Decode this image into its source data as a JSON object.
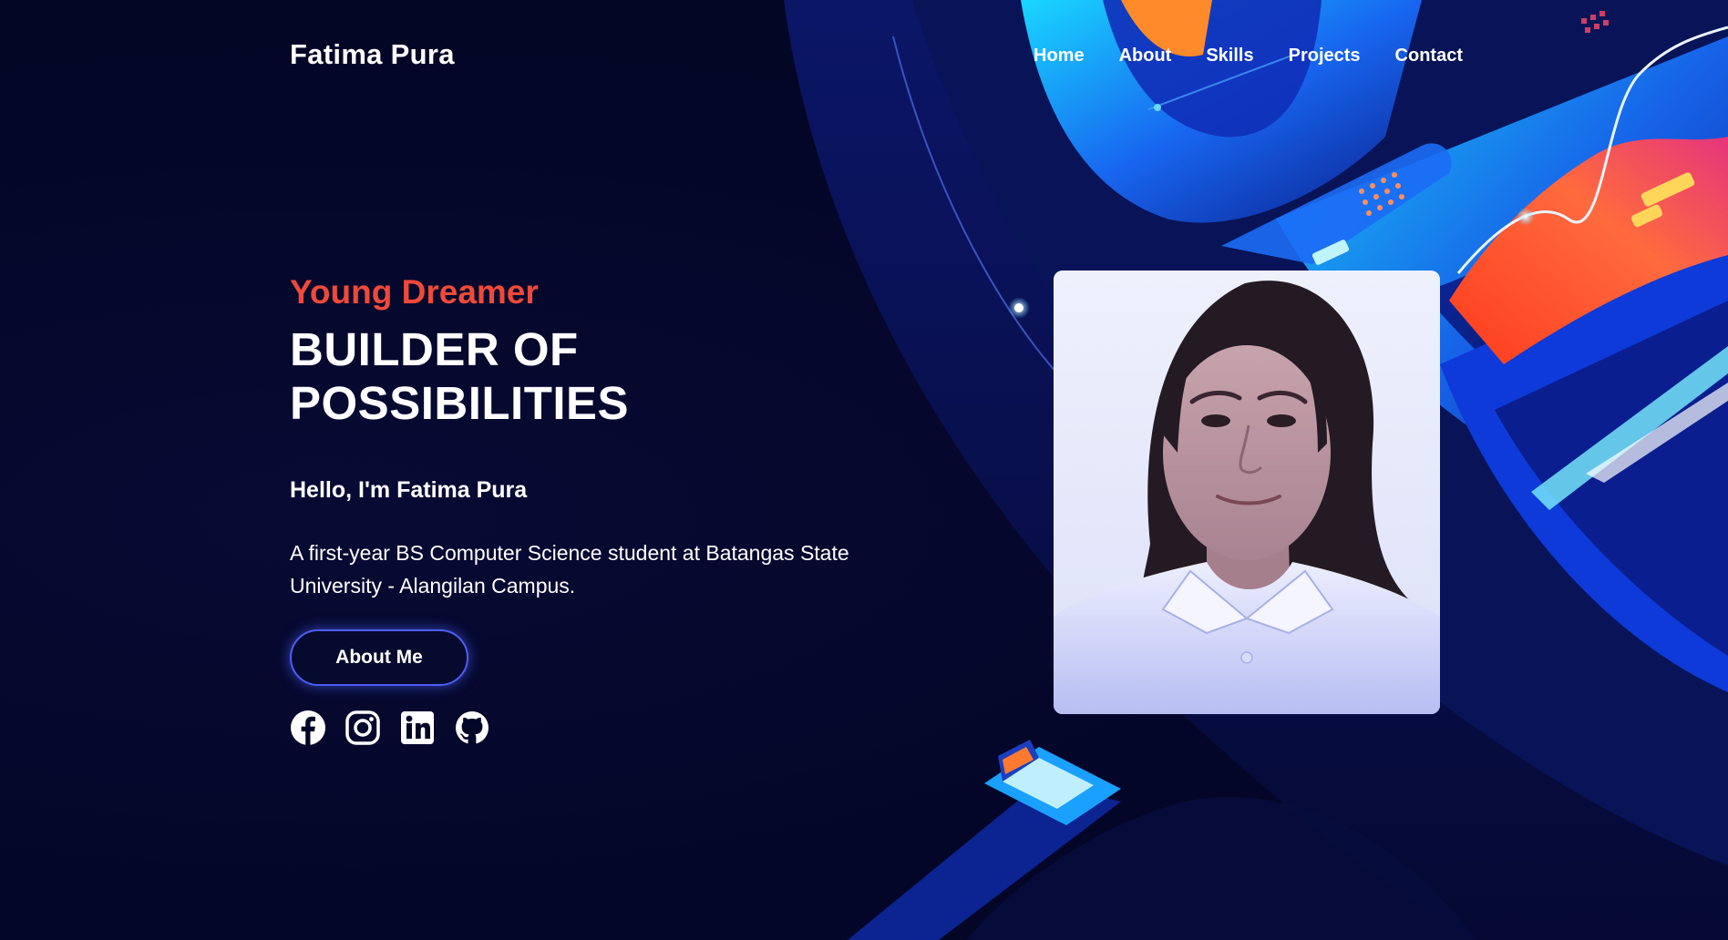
{
  "brand": {
    "name": "Fatima Pura"
  },
  "nav": {
    "items": [
      "Home",
      "About",
      "Skills",
      "Projects",
      "Contact"
    ]
  },
  "hero": {
    "tagline": "Young Dreamer",
    "headline": "BUILDER OF POSSIBILITIES",
    "greeting": "Hello, I'm Fatima Pura",
    "description": "A first-year BS Computer Science student at Batangas State University - Alangilan Campus.",
    "cta_label": "About Me"
  },
  "socials": {
    "icons": [
      "facebook-icon",
      "instagram-icon",
      "linkedin-icon",
      "github-icon"
    ]
  },
  "colors": {
    "background": "#040628",
    "accent": "#f0493a",
    "button_border": "#4d5cf5",
    "text": "#ffffff"
  }
}
